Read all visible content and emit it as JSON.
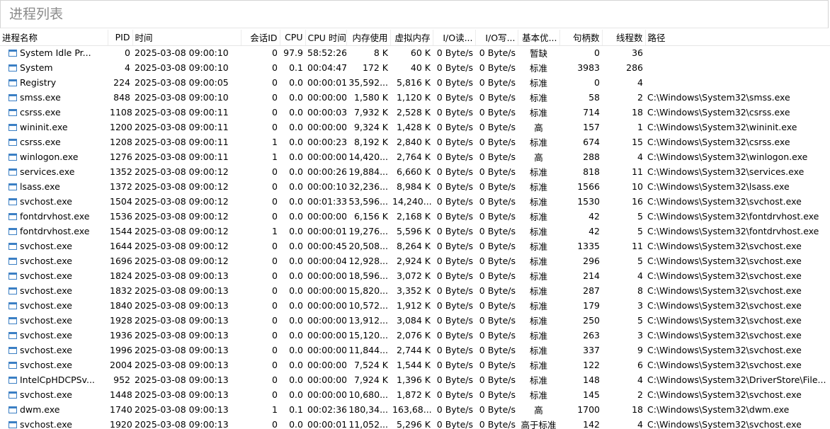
{
  "search": {
    "placeholder": "进程列表",
    "value": ""
  },
  "columns": [
    {
      "key": "name",
      "label": "进程名称",
      "align": "left"
    },
    {
      "key": "pid",
      "label": "PID",
      "align": "right"
    },
    {
      "key": "time",
      "label": "时间",
      "align": "left"
    },
    {
      "key": "session",
      "label": "会话ID",
      "align": "right"
    },
    {
      "key": "cpu",
      "label": "CPU",
      "align": "right"
    },
    {
      "key": "cpu_time",
      "label": "CPU 时间",
      "align": "right"
    },
    {
      "key": "mem",
      "label": "内存使用",
      "align": "right"
    },
    {
      "key": "vmem",
      "label": "虚拟内存",
      "align": "right"
    },
    {
      "key": "io_read",
      "label": "I/O读...",
      "align": "right"
    },
    {
      "key": "io_write",
      "label": "I/O写...",
      "align": "right"
    },
    {
      "key": "priority",
      "label": "基本优...",
      "align": "right"
    },
    {
      "key": "handles",
      "label": "句柄数",
      "align": "right"
    },
    {
      "key": "threads",
      "label": "线程数",
      "align": "right"
    },
    {
      "key": "path",
      "label": "路径",
      "align": "left"
    }
  ],
  "rows": [
    {
      "name": "System Idle Pr...",
      "pid": "0",
      "time": "2025-03-08 09:00:10",
      "session": "0",
      "cpu": "97.9",
      "cpu_time": "58:52:26",
      "mem": "8 K",
      "vmem": "60 K",
      "io_read": "0 Byte/s",
      "io_write": "0 Byte/s",
      "priority": "暂缺",
      "handles": "0",
      "threads": "36",
      "path": ""
    },
    {
      "name": "System",
      "pid": "4",
      "time": "2025-03-08 09:00:10",
      "session": "0",
      "cpu": "0.1",
      "cpu_time": "00:04:47",
      "mem": "172 K",
      "vmem": "40 K",
      "io_read": "0 Byte/s",
      "io_write": "0 Byte/s",
      "priority": "标准",
      "handles": "3983",
      "threads": "286",
      "path": ""
    },
    {
      "name": "Registry",
      "pid": "224",
      "time": "2025-03-08 09:00:05",
      "session": "0",
      "cpu": "0.0",
      "cpu_time": "00:00:01",
      "mem": "35,592...",
      "vmem": "5,816 K",
      "io_read": "0 Byte/s",
      "io_write": "0 Byte/s",
      "priority": "标准",
      "handles": "0",
      "threads": "4",
      "path": ""
    },
    {
      "name": "smss.exe",
      "pid": "848",
      "time": "2025-03-08 09:00:10",
      "session": "0",
      "cpu": "0.0",
      "cpu_time": "00:00:00",
      "mem": "1,580 K",
      "vmem": "1,120 K",
      "io_read": "0 Byte/s",
      "io_write": "0 Byte/s",
      "priority": "标准",
      "handles": "58",
      "threads": "2",
      "path": "C:\\Windows\\System32\\smss.exe"
    },
    {
      "name": "csrss.exe",
      "pid": "1108",
      "time": "2025-03-08 09:00:11",
      "session": "0",
      "cpu": "0.0",
      "cpu_time": "00:00:03",
      "mem": "7,932 K",
      "vmem": "2,528 K",
      "io_read": "0 Byte/s",
      "io_write": "0 Byte/s",
      "priority": "标准",
      "handles": "714",
      "threads": "18",
      "path": "C:\\Windows\\System32\\csrss.exe"
    },
    {
      "name": "wininit.exe",
      "pid": "1200",
      "time": "2025-03-08 09:00:11",
      "session": "0",
      "cpu": "0.0",
      "cpu_time": "00:00:00",
      "mem": "9,324 K",
      "vmem": "1,428 K",
      "io_read": "0 Byte/s",
      "io_write": "0 Byte/s",
      "priority": "高",
      "handles": "157",
      "threads": "1",
      "path": "C:\\Windows\\System32\\wininit.exe"
    },
    {
      "name": "csrss.exe",
      "pid": "1208",
      "time": "2025-03-08 09:00:11",
      "session": "1",
      "cpu": "0.0",
      "cpu_time": "00:00:23",
      "mem": "8,192 K",
      "vmem": "2,840 K",
      "io_read": "0 Byte/s",
      "io_write": "0 Byte/s",
      "priority": "标准",
      "handles": "674",
      "threads": "15",
      "path": "C:\\Windows\\System32\\csrss.exe"
    },
    {
      "name": "winlogon.exe",
      "pid": "1276",
      "time": "2025-03-08 09:00:11",
      "session": "1",
      "cpu": "0.0",
      "cpu_time": "00:00:00",
      "mem": "14,420...",
      "vmem": "2,764 K",
      "io_read": "0 Byte/s",
      "io_write": "0 Byte/s",
      "priority": "高",
      "handles": "288",
      "threads": "4",
      "path": "C:\\Windows\\System32\\winlogon.exe"
    },
    {
      "name": "services.exe",
      "pid": "1352",
      "time": "2025-03-08 09:00:12",
      "session": "0",
      "cpu": "0.0",
      "cpu_time": "00:00:26",
      "mem": "19,884...",
      "vmem": "6,660 K",
      "io_read": "0 Byte/s",
      "io_write": "0 Byte/s",
      "priority": "标准",
      "handles": "818",
      "threads": "11",
      "path": "C:\\Windows\\System32\\services.exe"
    },
    {
      "name": "lsass.exe",
      "pid": "1372",
      "time": "2025-03-08 09:00:12",
      "session": "0",
      "cpu": "0.0",
      "cpu_time": "00:00:10",
      "mem": "32,236...",
      "vmem": "8,984 K",
      "io_read": "0 Byte/s",
      "io_write": "0 Byte/s",
      "priority": "标准",
      "handles": "1566",
      "threads": "10",
      "path": "C:\\Windows\\System32\\lsass.exe"
    },
    {
      "name": "svchost.exe",
      "pid": "1504",
      "time": "2025-03-08 09:00:12",
      "session": "0",
      "cpu": "0.0",
      "cpu_time": "00:01:33",
      "mem": "53,596...",
      "vmem": "14,240...",
      "io_read": "0 Byte/s",
      "io_write": "0 Byte/s",
      "priority": "标准",
      "handles": "1530",
      "threads": "16",
      "path": "C:\\Windows\\System32\\svchost.exe"
    },
    {
      "name": "fontdrvhost.exe",
      "pid": "1536",
      "time": "2025-03-08 09:00:12",
      "session": "0",
      "cpu": "0.0",
      "cpu_time": "00:00:00",
      "mem": "6,156 K",
      "vmem": "2,168 K",
      "io_read": "0 Byte/s",
      "io_write": "0 Byte/s",
      "priority": "标准",
      "handles": "42",
      "threads": "5",
      "path": "C:\\Windows\\System32\\fontdrvhost.exe"
    },
    {
      "name": "fontdrvhost.exe",
      "pid": "1544",
      "time": "2025-03-08 09:00:12",
      "session": "1",
      "cpu": "0.0",
      "cpu_time": "00:00:01",
      "mem": "19,276...",
      "vmem": "5,596 K",
      "io_read": "0 Byte/s",
      "io_write": "0 Byte/s",
      "priority": "标准",
      "handles": "42",
      "threads": "5",
      "path": "C:\\Windows\\System32\\fontdrvhost.exe"
    },
    {
      "name": "svchost.exe",
      "pid": "1644",
      "time": "2025-03-08 09:00:12",
      "session": "0",
      "cpu": "0.0",
      "cpu_time": "00:00:45",
      "mem": "20,508...",
      "vmem": "8,264 K",
      "io_read": "0 Byte/s",
      "io_write": "0 Byte/s",
      "priority": "标准",
      "handles": "1335",
      "threads": "11",
      "path": "C:\\Windows\\System32\\svchost.exe"
    },
    {
      "name": "svchost.exe",
      "pid": "1696",
      "time": "2025-03-08 09:00:12",
      "session": "0",
      "cpu": "0.0",
      "cpu_time": "00:00:04",
      "mem": "12,928...",
      "vmem": "2,924 K",
      "io_read": "0 Byte/s",
      "io_write": "0 Byte/s",
      "priority": "标准",
      "handles": "296",
      "threads": "5",
      "path": "C:\\Windows\\System32\\svchost.exe"
    },
    {
      "name": "svchost.exe",
      "pid": "1824",
      "time": "2025-03-08 09:00:13",
      "session": "0",
      "cpu": "0.0",
      "cpu_time": "00:00:00",
      "mem": "18,596...",
      "vmem": "3,072 K",
      "io_read": "0 Byte/s",
      "io_write": "0 Byte/s",
      "priority": "标准",
      "handles": "214",
      "threads": "4",
      "path": "C:\\Windows\\System32\\svchost.exe"
    },
    {
      "name": "svchost.exe",
      "pid": "1832",
      "time": "2025-03-08 09:00:13",
      "session": "0",
      "cpu": "0.0",
      "cpu_time": "00:00:00",
      "mem": "15,820...",
      "vmem": "3,352 K",
      "io_read": "0 Byte/s",
      "io_write": "0 Byte/s",
      "priority": "标准",
      "handles": "287",
      "threads": "8",
      "path": "C:\\Windows\\System32\\svchost.exe"
    },
    {
      "name": "svchost.exe",
      "pid": "1840",
      "time": "2025-03-08 09:00:13",
      "session": "0",
      "cpu": "0.0",
      "cpu_time": "00:00:00",
      "mem": "10,572...",
      "vmem": "1,912 K",
      "io_read": "0 Byte/s",
      "io_write": "0 Byte/s",
      "priority": "标准",
      "handles": "179",
      "threads": "3",
      "path": "C:\\Windows\\System32\\svchost.exe"
    },
    {
      "name": "svchost.exe",
      "pid": "1928",
      "time": "2025-03-08 09:00:13",
      "session": "0",
      "cpu": "0.0",
      "cpu_time": "00:00:00",
      "mem": "13,912...",
      "vmem": "3,084 K",
      "io_read": "0 Byte/s",
      "io_write": "0 Byte/s",
      "priority": "标准",
      "handles": "250",
      "threads": "5",
      "path": "C:\\Windows\\System32\\svchost.exe"
    },
    {
      "name": "svchost.exe",
      "pid": "1936",
      "time": "2025-03-08 09:00:13",
      "session": "0",
      "cpu": "0.0",
      "cpu_time": "00:00:00",
      "mem": "15,120...",
      "vmem": "2,076 K",
      "io_read": "0 Byte/s",
      "io_write": "0 Byte/s",
      "priority": "标准",
      "handles": "263",
      "threads": "3",
      "path": "C:\\Windows\\System32\\svchost.exe"
    },
    {
      "name": "svchost.exe",
      "pid": "1996",
      "time": "2025-03-08 09:00:13",
      "session": "0",
      "cpu": "0.0",
      "cpu_time": "00:00:00",
      "mem": "11,844...",
      "vmem": "2,744 K",
      "io_read": "0 Byte/s",
      "io_write": "0 Byte/s",
      "priority": "标准",
      "handles": "337",
      "threads": "9",
      "path": "C:\\Windows\\System32\\svchost.exe"
    },
    {
      "name": "svchost.exe",
      "pid": "2004",
      "time": "2025-03-08 09:00:13",
      "session": "0",
      "cpu": "0.0",
      "cpu_time": "00:00:00",
      "mem": "7,524 K",
      "vmem": "1,544 K",
      "io_read": "0 Byte/s",
      "io_write": "0 Byte/s",
      "priority": "标准",
      "handles": "122",
      "threads": "6",
      "path": "C:\\Windows\\System32\\svchost.exe"
    },
    {
      "name": "IntelCpHDCPSv...",
      "pid": "952",
      "time": "2025-03-08 09:00:13",
      "session": "0",
      "cpu": "0.0",
      "cpu_time": "00:00:00",
      "mem": "7,924 K",
      "vmem": "1,396 K",
      "io_read": "0 Byte/s",
      "io_write": "0 Byte/s",
      "priority": "标准",
      "handles": "148",
      "threads": "4",
      "path": "C:\\Windows\\System32\\DriverStore\\File..."
    },
    {
      "name": "svchost.exe",
      "pid": "1448",
      "time": "2025-03-08 09:00:13",
      "session": "0",
      "cpu": "0.0",
      "cpu_time": "00:00:00",
      "mem": "10,680...",
      "vmem": "1,872 K",
      "io_read": "0 Byte/s",
      "io_write": "0 Byte/s",
      "priority": "标准",
      "handles": "145",
      "threads": "2",
      "path": "C:\\Windows\\System32\\svchost.exe"
    },
    {
      "name": "dwm.exe",
      "pid": "1740",
      "time": "2025-03-08 09:00:13",
      "session": "1",
      "cpu": "0.1",
      "cpu_time": "00:02:36",
      "mem": "180,34...",
      "vmem": "163,68...",
      "io_read": "0 Byte/s",
      "io_write": "0 Byte/s",
      "priority": "高",
      "handles": "1700",
      "threads": "18",
      "path": "C:\\Windows\\System32\\dwm.exe"
    },
    {
      "name": "svchost.exe",
      "pid": "1920",
      "time": "2025-03-08 09:00:13",
      "session": "0",
      "cpu": "0.0",
      "cpu_time": "00:00:01",
      "mem": "11,052...",
      "vmem": "5,296 K",
      "io_read": "0 Byte/s",
      "io_write": "0 Byte/s",
      "priority": "高于标准",
      "handles": "142",
      "threads": "4",
      "path": "C:\\Windows\\System32\\svchost.exe"
    }
  ]
}
